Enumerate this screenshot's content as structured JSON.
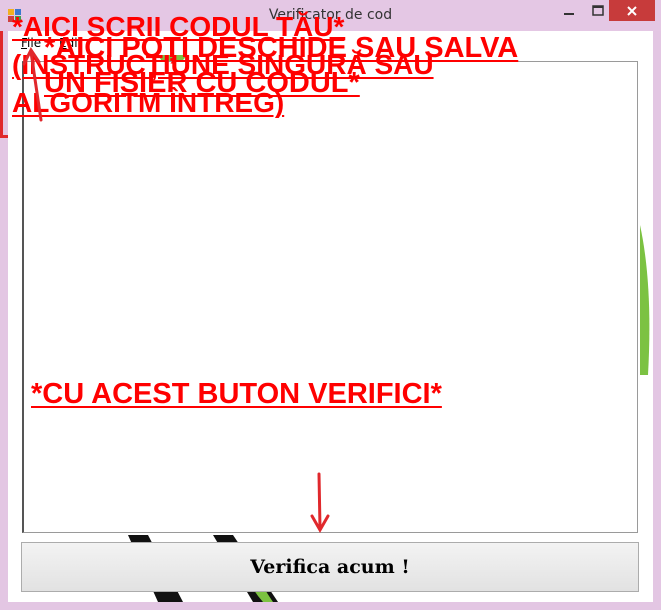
{
  "window": {
    "title": "Verificator de cod"
  },
  "menu": {
    "file_prefix": "F",
    "file_rest": "ile",
    "edit_prefix": "E",
    "edit_rest": "dit"
  },
  "editor": {
    "value": ""
  },
  "verify_button": {
    "label": "Verifica acum !"
  },
  "annotations": {
    "file_line1": "*AICI POȚI DESCHIDE SAU SALVA",
    "file_line2": "UN FIȘIER CU CODUL*",
    "code_line1": "*AICI SCRII CODUL TĂU*",
    "code_line2": "(INSTRUCȚIUNE SINGURĂ SAU",
    "code_line3": "ALGORITM ÎNTREG)",
    "button_line": "*CU ACEST BUTON VERIFICI*"
  },
  "colors": {
    "annotation": "#ff0000",
    "title_bar": "#e4c7e4",
    "close_button": "#c73b3b",
    "background_accent": "#7cc242"
  },
  "icons": {
    "app": "app-icon",
    "minimize": "minimize-icon",
    "maximize": "maximize-icon",
    "close": "close-icon"
  }
}
